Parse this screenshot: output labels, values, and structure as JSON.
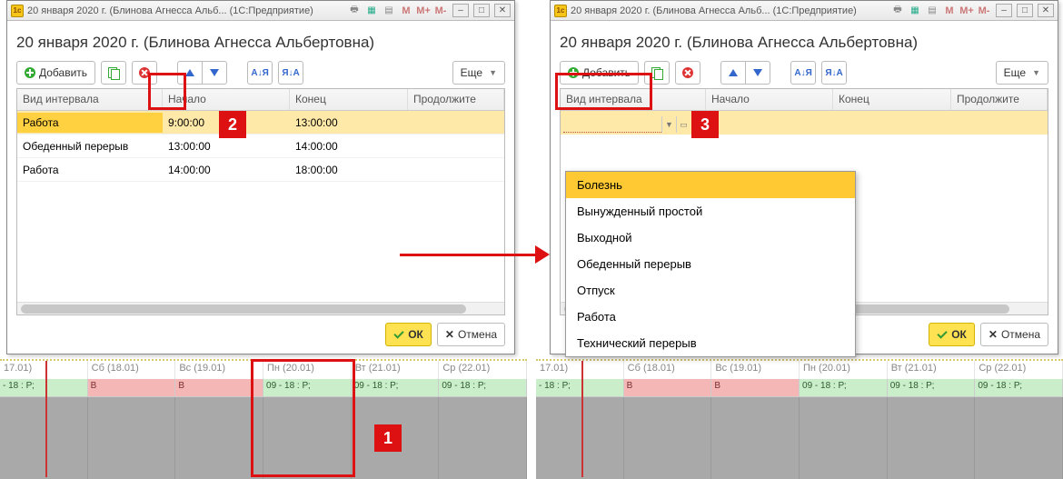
{
  "titlebar": {
    "app_icon_label": "1c",
    "title": "20 января 2020 г. (Блинова Агнесса Альб... (1С:Предприятие)",
    "m": "M",
    "mplus": "M+",
    "mminus": "M-"
  },
  "page_title": "20 января 2020 г. (Блинова Агнесса Альбертовна)",
  "toolbar": {
    "add": "Добавить",
    "more": "Еще",
    "sort_az": "А↓Я",
    "sort_za": "Я↓А"
  },
  "columns": {
    "type": "Вид интервала",
    "start": "Начало",
    "end": "Конец",
    "dur": "Продолжите"
  },
  "rows_left": [
    {
      "type": "Работа",
      "start": "9:00:00",
      "end": "13:00:00",
      "selected": true
    },
    {
      "type": "Обеденный перерыв",
      "start": "13:00:00",
      "end": "14:00:00"
    },
    {
      "type": "Работа",
      "start": "14:00:00",
      "end": "18:00:00"
    }
  ],
  "buttons": {
    "ok": "ОК",
    "cancel": "Отмена"
  },
  "callouts": {
    "c1": "1",
    "c2": "2",
    "c3": "3"
  },
  "dropdown": {
    "options": [
      "Болезнь",
      "Вынужденный простой",
      "Выходной",
      "Обеденный перерыв",
      "Отпуск",
      "Работа",
      "Технический перерыв"
    ],
    "selected_index": 0,
    "input_value": ""
  },
  "timeline": {
    "days": [
      {
        "label": "17.01)",
        "cell": "- 18 : Р;",
        "cls": "green"
      },
      {
        "label": "Сб (18.01)",
        "cell": "В",
        "cls": "pink"
      },
      {
        "label": "Вс (19.01)",
        "cell": "В",
        "cls": "pink"
      },
      {
        "label": "Пн (20.01)",
        "cell": "09 - 18 : Р;",
        "cls": "green"
      },
      {
        "label": "Вт (21.01)",
        "cell": "09 - 18 : Р;",
        "cls": "green"
      },
      {
        "label": "Ср (22.01)",
        "cell": "09 - 18 : Р;",
        "cls": "green"
      }
    ]
  }
}
